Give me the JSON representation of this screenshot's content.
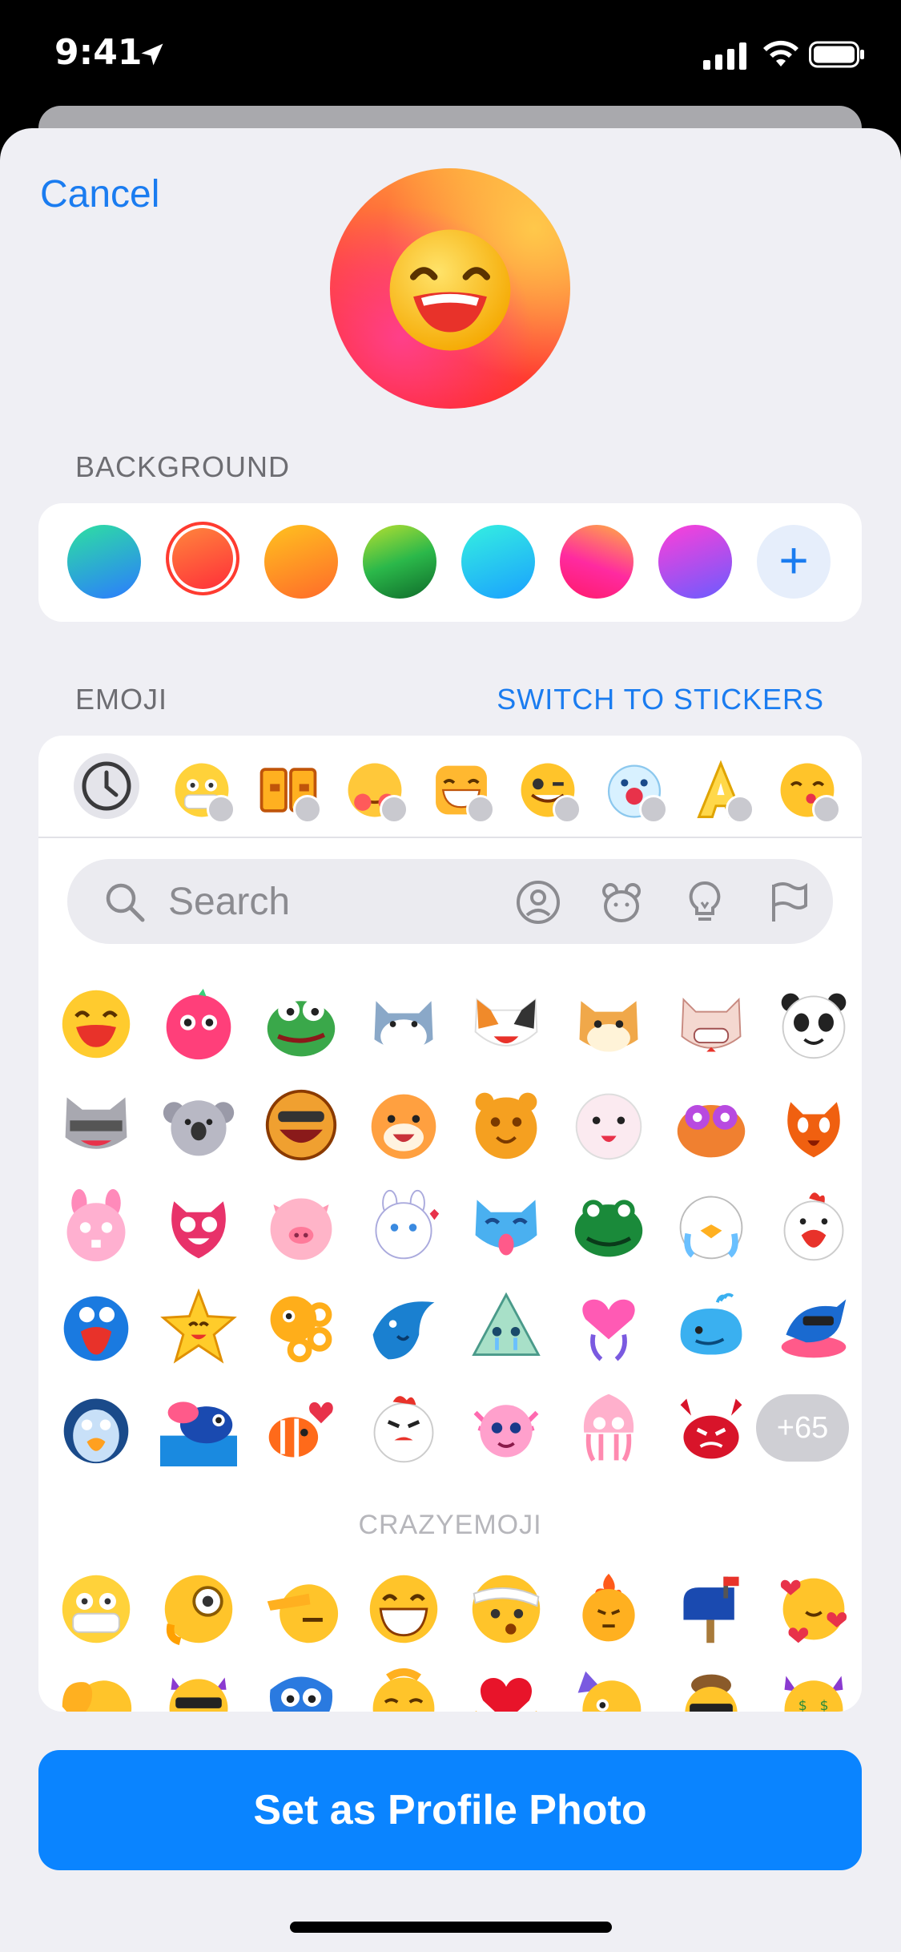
{
  "status_bar": {
    "time": "9:41"
  },
  "header": {
    "cancel_label": "Cancel"
  },
  "background_section": {
    "label": "BACKGROUND",
    "swatches": [
      {
        "name": "green-blue",
        "colors": [
          "#2ee0a0",
          "#2b7bff"
        ]
      },
      {
        "name": "red-orange",
        "colors": [
          "#ff5a3c",
          "#ff2a6a"
        ],
        "selected": true
      },
      {
        "name": "orange",
        "colors": [
          "#ffc21f",
          "#ff6a2a"
        ]
      },
      {
        "name": "green",
        "colors": [
          "#7ee04a",
          "#0f8a2a"
        ]
      },
      {
        "name": "cyan",
        "colors": [
          "#35f0e0",
          "#1aa0ff"
        ]
      },
      {
        "name": "pink",
        "colors": [
          "#ff2aa0",
          "#ffb040"
        ]
      },
      {
        "name": "purple",
        "colors": [
          "#ff3fd8",
          "#6a5cff"
        ]
      }
    ],
    "add_label": "+"
  },
  "emoji_section": {
    "label": "EMOJI",
    "switch_label": "SWITCH TO STICKERS",
    "search_placeholder": "Search",
    "more_count": "+65",
    "pack_title": "CRAZYEMOJI"
  },
  "cta": {
    "label": "Set as Profile Photo"
  },
  "colors": {
    "accent": "#0a84ff",
    "link": "#1a7cf0"
  }
}
